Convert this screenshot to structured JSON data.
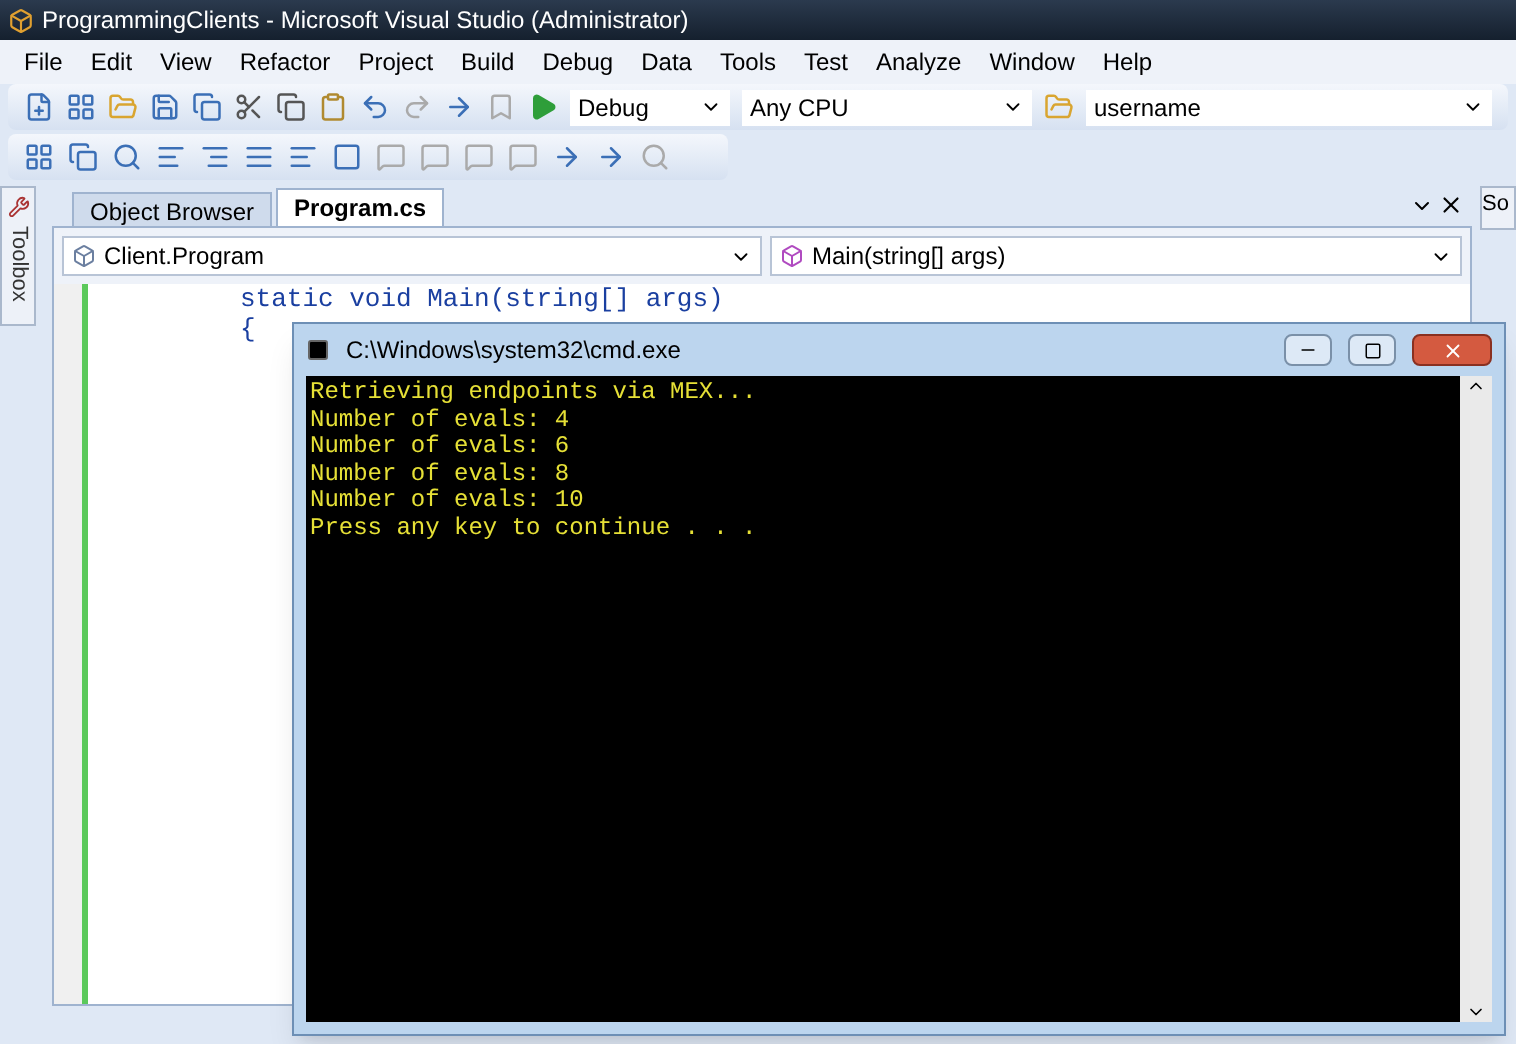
{
  "window": {
    "title": "ProgrammingClients - Microsoft Visual Studio (Administrator)"
  },
  "menu": [
    "File",
    "Edit",
    "View",
    "Refactor",
    "Project",
    "Build",
    "Debug",
    "Data",
    "Tools",
    "Test",
    "Analyze",
    "Window",
    "Help"
  ],
  "toolbar": {
    "configuration": "Debug",
    "platform": "Any CPU",
    "user": "username"
  },
  "toolbox_tab": "Toolbox",
  "right_tab": "So",
  "tabs": [
    {
      "label": "Object Browser",
      "selected": false
    },
    {
      "label": "Program.cs",
      "selected": true
    }
  ],
  "editor": {
    "type_dropdown": "Client.Program",
    "member_dropdown": "Main(string[] args)",
    "lines": [
      "static void Main(string[] args)",
      "{"
    ]
  },
  "console": {
    "title": "C:\\Windows\\system32\\cmd.exe",
    "lines": [
      "Retrieving endpoints via MEX...",
      "Number of evals: 4",
      "Number of evals: 6",
      "Number of evals: 8",
      "Number of evals: 10",
      "Press any key to continue . . ."
    ]
  }
}
